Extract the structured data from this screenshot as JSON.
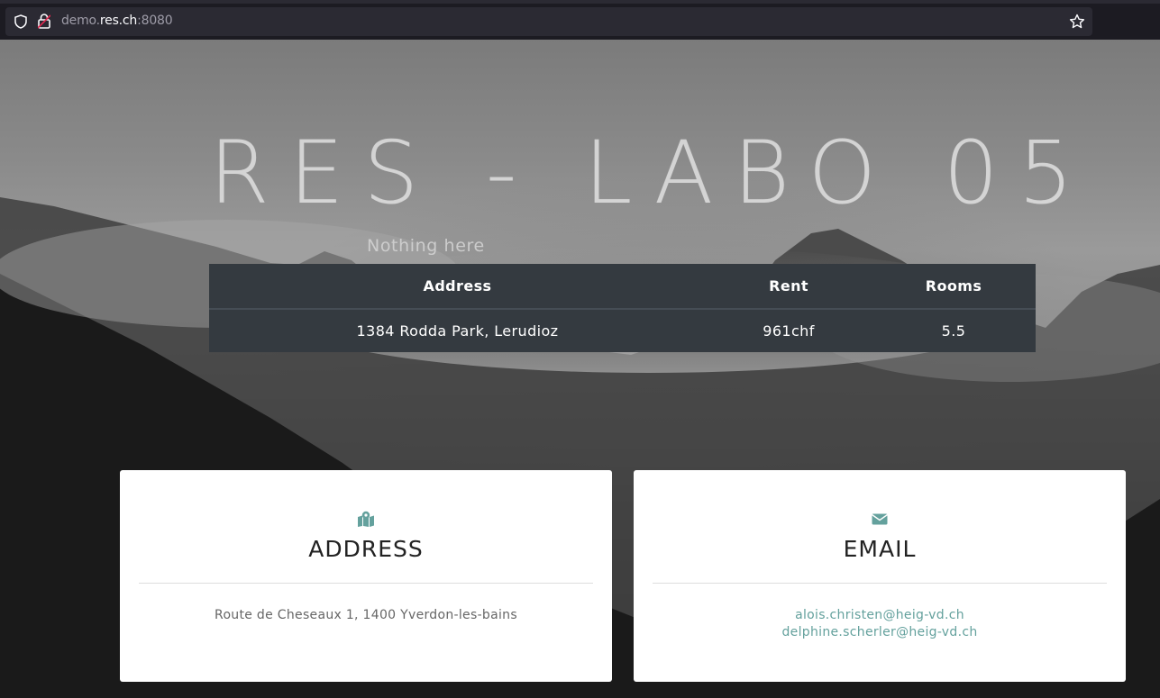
{
  "browser": {
    "url_prefix": "demo.",
    "url_host": "res.ch",
    "url_port": ":8080"
  },
  "hero": {
    "title": "RES - LABO 05",
    "subtitle": "Nothing here"
  },
  "listing": {
    "headers": [
      "Address",
      "Rent",
      "Rooms"
    ],
    "rows": [
      [
        "1384 Rodda Park, Lerudioz",
        "961chf",
        "5.5"
      ]
    ]
  },
  "cards": {
    "address": {
      "icon": "map-marked-icon",
      "title": "ADDRESS",
      "text": "Route de Cheseaux 1, 1400 Yverdon-les-bains"
    },
    "email": {
      "icon": "envelope-icon",
      "title": "EMAIL",
      "links": [
        "alois.christen@heig-vd.ch",
        "delphine.scherler@heig-vd.ch"
      ]
    }
  },
  "colors": {
    "accent": "#64a19d",
    "table_bg": "#343a40"
  }
}
